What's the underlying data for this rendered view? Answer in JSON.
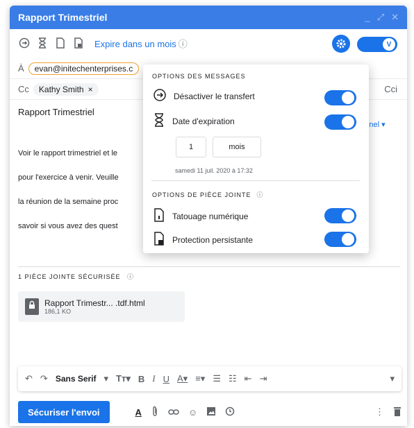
{
  "window": {
    "title": "Rapport Trimestriel"
  },
  "toolbar": {
    "expire_label": "Expire dans un mois",
    "info_glyph": "ⓘ"
  },
  "to": {
    "label": "À",
    "email": "evan@initechenterprises.c"
  },
  "cc": {
    "label": "Cc",
    "name": "Kathy Smith",
    "remove": "×",
    "cci": "Cci"
  },
  "subject": "Rapport Trimestriel",
  "personal_link": "rsonnel ▾",
  "body": {
    "lines": [
      "Voir le rapport trimestriel et le",
      "pour l'exercice à venir. Veuille",
      "la réunion de la semaine proc",
      "savoir si vous avez des quest"
    ]
  },
  "attachments": {
    "section_title": "1 PIÈCE JOINTE SÉCURISÉE",
    "items": [
      {
        "name": "Rapport Trimestr... .tdf.html",
        "size": "186,1 KO"
      }
    ]
  },
  "format_bar": {
    "font": "Sans Serif"
  },
  "send_button": "Sécuriser l'envoi",
  "popup": {
    "messages_title": "OPTIONS DES MESSAGES",
    "disable_forward": "Désactiver le transfert",
    "expiration": "Date d'expiration",
    "amount": "1",
    "unit": "mois",
    "date_text": "samedi 11 juil. 2020 à 17:32",
    "attachment_title": "OPTIONS DE PIÈCE JOINTE",
    "watermark": "Tatouage numérique",
    "persistent": "Protection persistante"
  },
  "colors": {
    "accent": "#1a73e8",
    "title_bar": "#3a7de6"
  }
}
